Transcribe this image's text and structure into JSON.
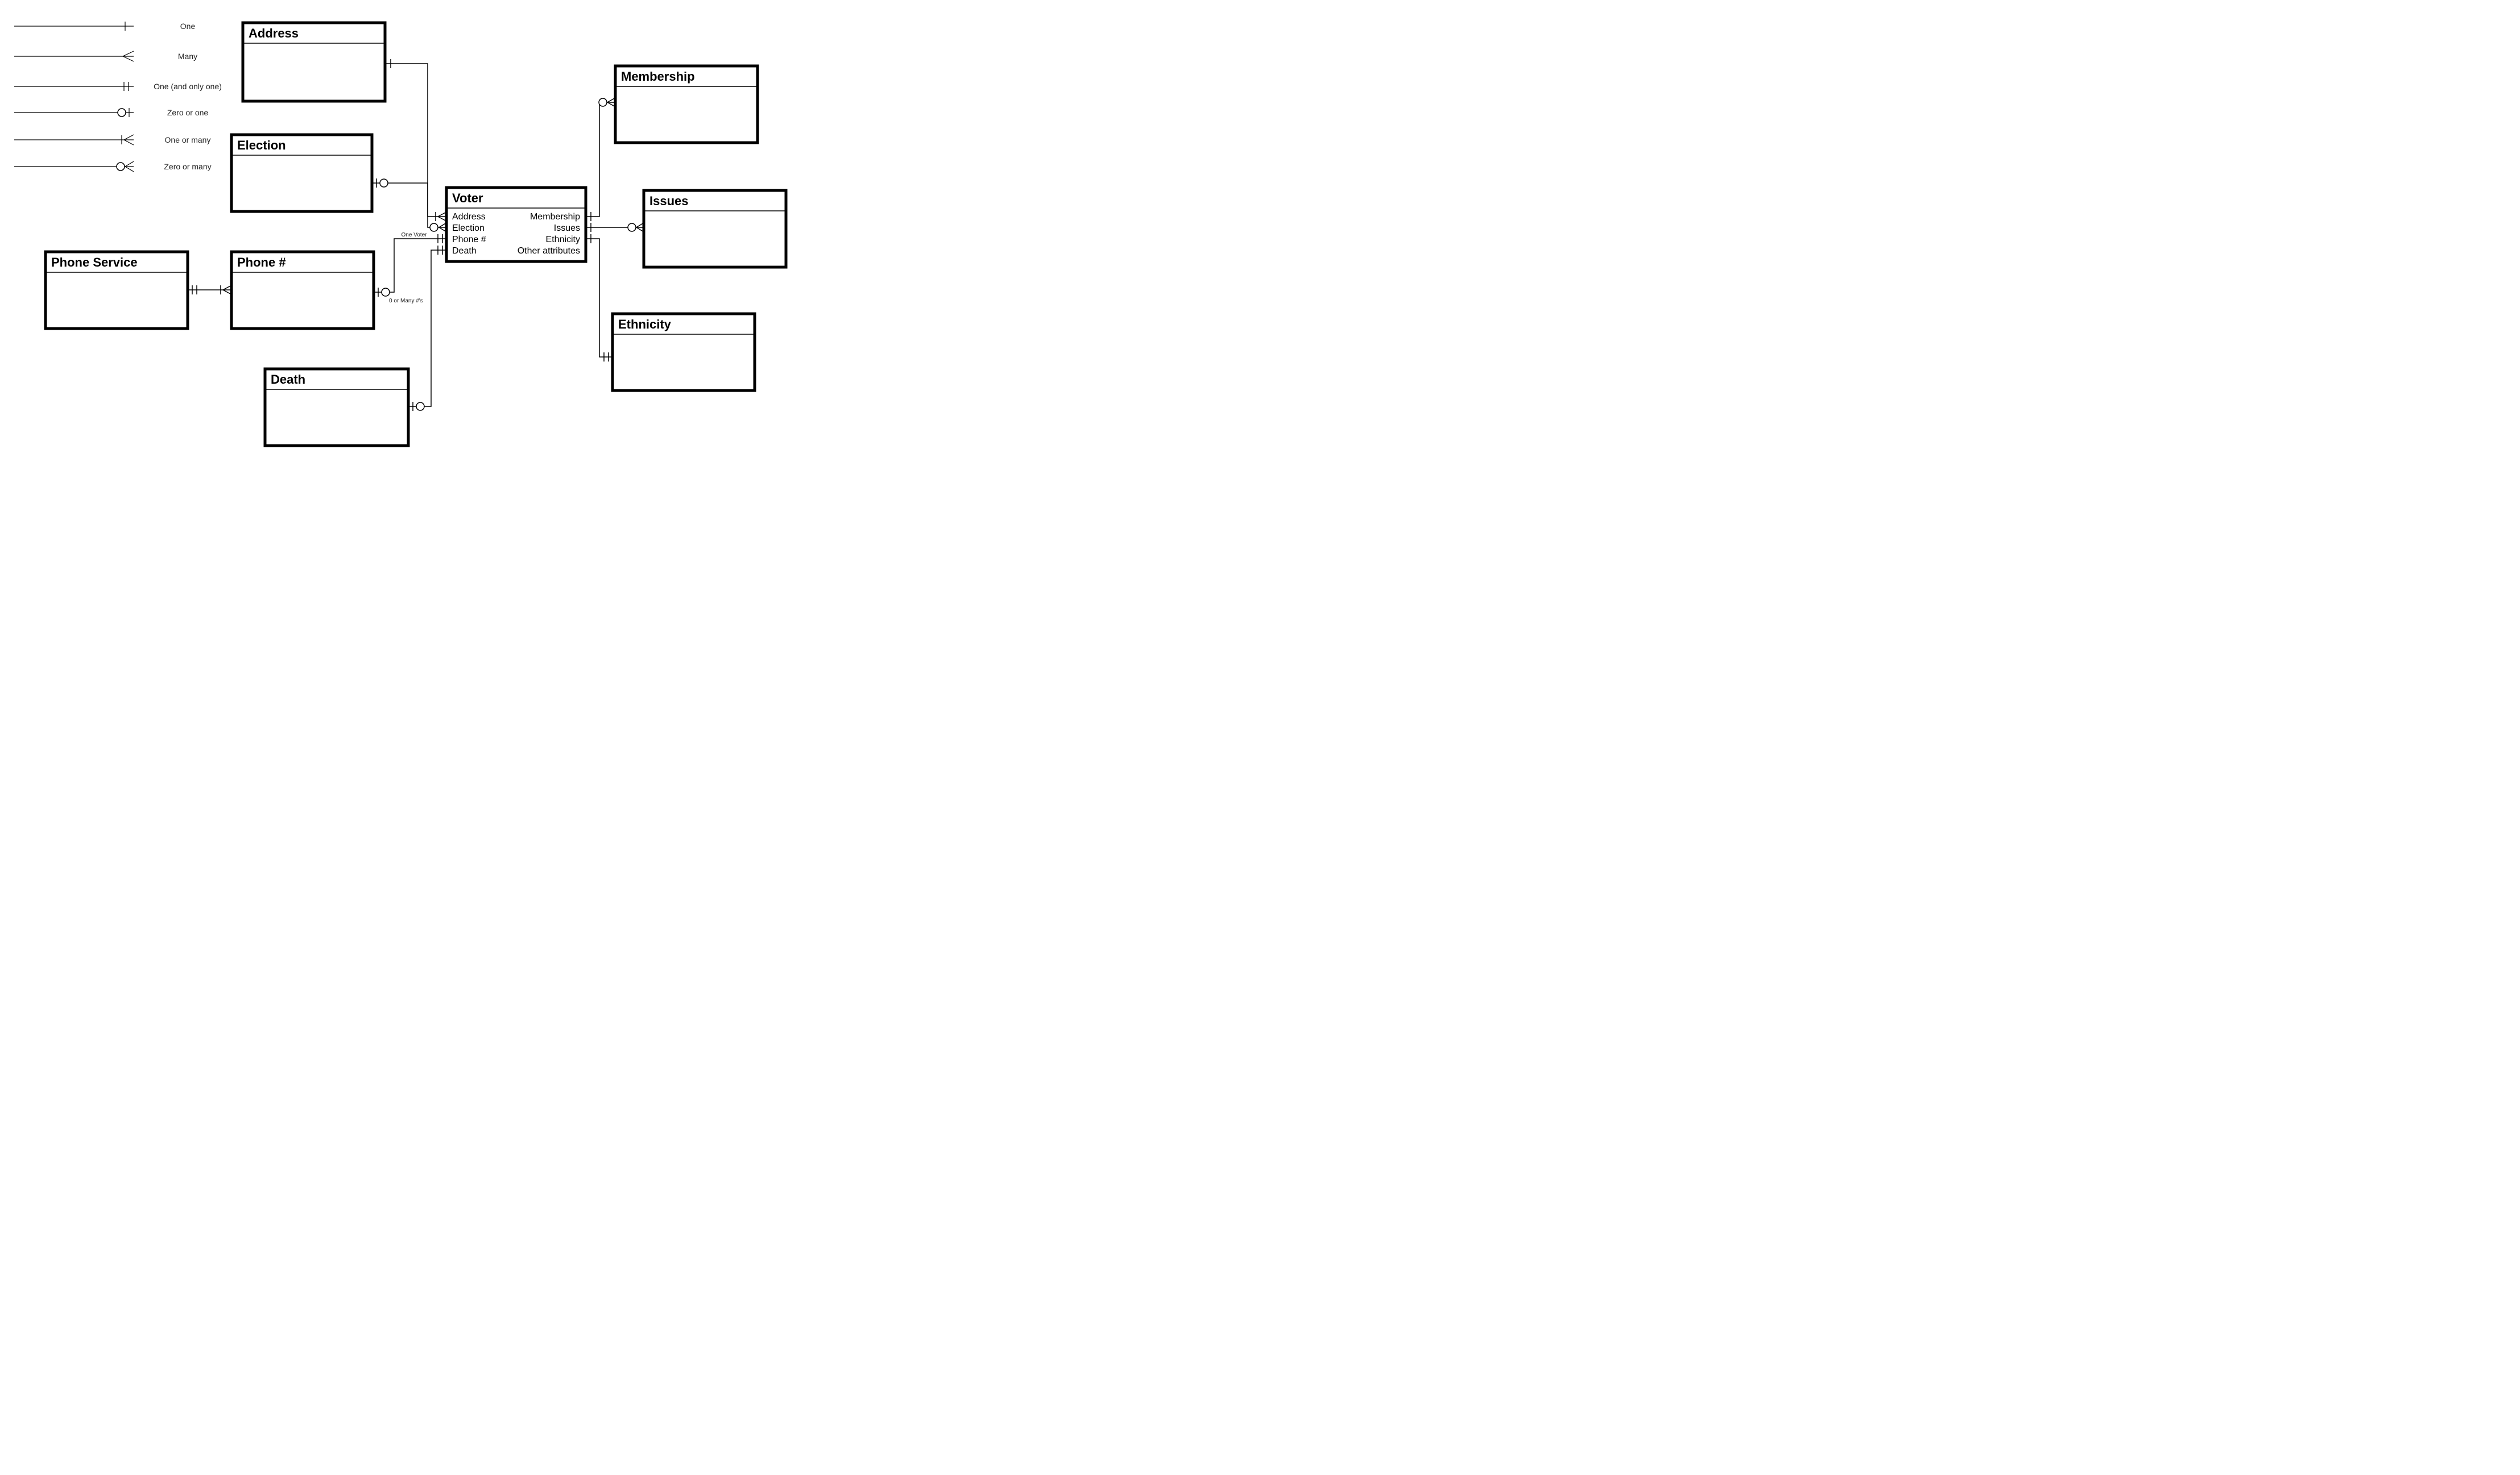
{
  "legend": {
    "one": "One",
    "many": "Many",
    "one_only": "One (and only one)",
    "zero_one": "Zero or one",
    "one_many": "One or many",
    "zero_many": "Zero or many"
  },
  "entities": {
    "address": {
      "title": "Address"
    },
    "election": {
      "title": "Election"
    },
    "phone_service": {
      "title": "Phone Service"
    },
    "phone_number": {
      "title": "Phone #"
    },
    "death": {
      "title": "Death"
    },
    "voter": {
      "title": "Voter",
      "left_attrs": [
        "Address",
        "Election",
        "Phone #",
        "Death"
      ],
      "right_attrs": [
        "Membership",
        "Issues",
        "Ethnicity",
        "Other attributes"
      ]
    },
    "membership": {
      "title": "Membership"
    },
    "issues": {
      "title": "Issues"
    },
    "ethnicity": {
      "title": "Ethnicity"
    }
  },
  "conn_labels": {
    "one_voter": "One Voter",
    "zero_many_phones": "0 or Many #'s"
  },
  "chart_data": {
    "type": "diagram",
    "notation": "crows-foot-er",
    "entities": [
      "Address",
      "Election",
      "Phone Service",
      "Phone #",
      "Death",
      "Voter",
      "Membership",
      "Issues",
      "Ethnicity"
    ],
    "voter_attributes_left": [
      "Address",
      "Election",
      "Phone #",
      "Death"
    ],
    "voter_attributes_right": [
      "Membership",
      "Issues",
      "Ethnicity",
      "Other attributes"
    ],
    "relationships": [
      {
        "from": "Address",
        "to": "Voter",
        "from_card": "one",
        "to_card": "one-or-many"
      },
      {
        "from": "Election",
        "to": "Voter",
        "from_card": "zero-or-one",
        "to_card": "zero-or-many"
      },
      {
        "from": "Phone #",
        "to": "Voter",
        "from_card": "zero-or-one",
        "to_card": "one-and-only-one",
        "from_label": "0 or Many #'s",
        "to_label": "One Voter"
      },
      {
        "from": "Phone Service",
        "to": "Phone #",
        "from_card": "one-and-only-one",
        "to_card": "one-or-many"
      },
      {
        "from": "Death",
        "to": "Voter",
        "from_card": "zero-or-one",
        "to_card": "one-and-only-one"
      },
      {
        "from": "Voter",
        "to": "Membership",
        "from_card": "one",
        "to_card": "zero-or-many"
      },
      {
        "from": "Voter",
        "to": "Issues",
        "from_card": "one",
        "to_card": "zero-or-many"
      },
      {
        "from": "Voter",
        "to": "Ethnicity",
        "from_card": "one",
        "to_card": "one-and-only-one"
      }
    ],
    "legend": [
      {
        "symbol": "single-tick",
        "meaning": "One"
      },
      {
        "symbol": "crows-foot",
        "meaning": "Many"
      },
      {
        "symbol": "double-tick",
        "meaning": "One (and only one)"
      },
      {
        "symbol": "circle-tick",
        "meaning": "Zero or one"
      },
      {
        "symbol": "tick-crows-foot",
        "meaning": "One or many"
      },
      {
        "symbol": "circle-crows-foot",
        "meaning": "Zero or many"
      }
    ]
  }
}
